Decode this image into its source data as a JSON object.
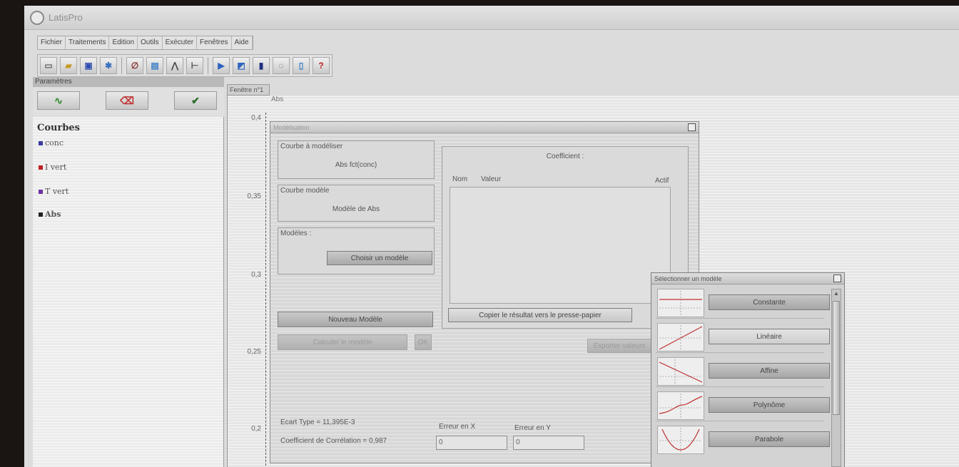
{
  "app": {
    "title": "LatisPro"
  },
  "menu": [
    "Fichier",
    "Traitements",
    "Edition",
    "Outils",
    "Exécuter",
    "Fenêtres",
    "Aide"
  ],
  "toolbar": {
    "icons": [
      "new-file-icon",
      "open-folder-icon",
      "save-icon",
      "acquisition-icon",
      "cycle-icon",
      "screen-icon",
      "waveform-icon",
      "sequence-icon",
      "arrow-right-icon",
      "export-icon",
      "device-icon",
      "refresh-icon",
      "clipboard-icon",
      "help-icon"
    ],
    "help_glyph": "?"
  },
  "parameters": {
    "title": "Paramètres",
    "buttons": [
      "waveform-icon",
      "eraser-icon",
      "checkmark-icon"
    ]
  },
  "courbes": {
    "title": "Courbes",
    "items": [
      {
        "label": "conc",
        "color": "#3a3aa0"
      },
      {
        "label": "I vert",
        "color": "#c02020"
      },
      {
        "label": "T vert",
        "color": "#7030a0"
      },
      {
        "label": "Abs",
        "color": "#222222"
      }
    ]
  },
  "graph": {
    "tab": "Fenêtre n°1",
    "y_axis_label": "Abs",
    "y_ticks": [
      "0,4",
      "0,35",
      "0,3",
      "0,25",
      "0,2"
    ]
  },
  "modeliser": {
    "title": "Modélisation",
    "courbe_a_modeliser": {
      "title": "Courbe à modéliser",
      "value": "Abs  fct(conc)"
    },
    "courbe_modele": {
      "title": "Courbe modèle",
      "value": "Modèle de Abs"
    },
    "modeles": {
      "title": "Modèles :",
      "choose_button": "Choisir un modèle"
    },
    "nouveau_modele": "Nouveau Modèle",
    "calculer_button": "Calculer le modèle",
    "ok_button": "OK",
    "ecart_type": "Ecart Type = 11,395E-3",
    "correlation": "Coefficient de Corrélation = 0,987",
    "erreur_x": {
      "label": "Erreur en X",
      "value": "0"
    },
    "erreur_y": {
      "label": "Erreur en Y",
      "value": "0"
    },
    "coefficients": {
      "title": "Coefficient :",
      "col_nom": "Nom",
      "col_valeur": "Valeur",
      "col_actif": "Actif",
      "copy_button": "Copier le résultat vers le presse-papier",
      "faded_button": "Exporter valeurs"
    }
  },
  "selector": {
    "title": "Sélectionner un modèle",
    "models": [
      "Constante",
      "Linéaire",
      "Affine",
      "Polynôme",
      "Parabole"
    ]
  }
}
